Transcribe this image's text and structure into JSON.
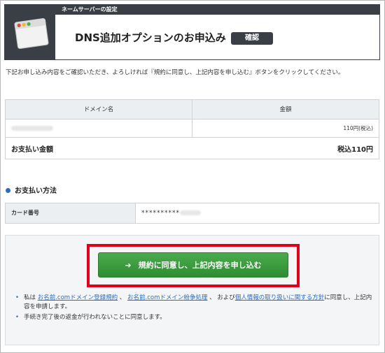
{
  "header": {
    "section_label": "ネームサーバーの設定",
    "title": "DNS追加オプションのお申込み",
    "badge": "確認"
  },
  "intro_text": "下記お申し込み内容をご確認いただき、よろしければ『規約に同意し、上記内容を申し込む』ボタンをクリックしてください。",
  "order_table": {
    "col_domain": "ドメイン名",
    "col_amount": "金額",
    "row_amount": "110円(税込)",
    "total_label": "お支払い金額",
    "total_value": "税込110円"
  },
  "payment": {
    "title": "お支払い方法",
    "card_label": "カード番号",
    "card_value": "**********"
  },
  "agree": {
    "button_label": "規約に同意し、上記内容を申し込む",
    "terms_prefix": "私は",
    "link1": "お名前.comドメイン登録規約",
    "sep1": "、",
    "link2": "お名前.comドメイン紛争処理",
    "sep2": "、 および",
    "link3": "個人情報の取り扱いに関する方針",
    "terms_suffix": "に同意し、上記内容を申請します。",
    "refund_note": "手続き完了後の返金が行われないことに同意します。"
  },
  "colors": {
    "header_dark": "#3a3f46",
    "button_green": "#3d9d3f",
    "highlight_red": "#e0001b",
    "link_blue": "#2a6cc4"
  },
  "icons": {
    "header_icon": "browser-window-icon",
    "button_icon": "arrow-right-icon"
  }
}
